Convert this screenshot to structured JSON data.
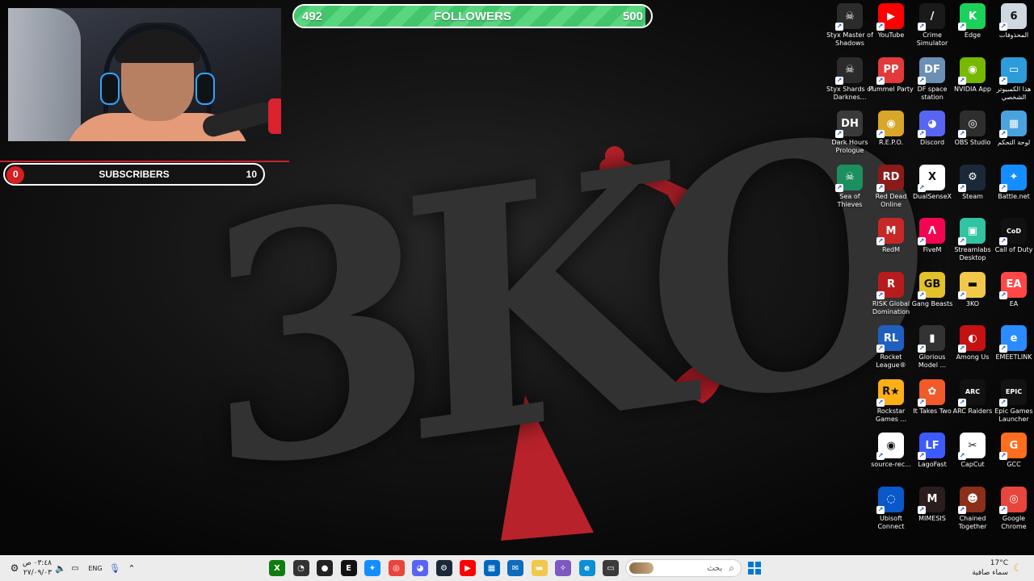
{
  "overlay": {
    "followers": {
      "current": "492",
      "title": "FOLLOWERS",
      "goal": "500",
      "progress": 0.984
    },
    "subscribers": {
      "current": "0",
      "title": "SUBSCRIBERS",
      "goal": "10",
      "progress": 0.0
    }
  },
  "wallpaper": {
    "logo_text": "3KO"
  },
  "desktop_icons": [
    {
      "label": "Styx Master of Shadows",
      "icon": "styx-icon",
      "color": "#2b2b2b",
      "glyph": "☠"
    },
    {
      "label": "YouTube",
      "icon": "youtube-icon",
      "color": "#ff0000",
      "glyph": "▶"
    },
    {
      "label": "Crime Simulator",
      "icon": "crime-simulator-icon",
      "color": "#1a1a1a",
      "glyph": "/"
    },
    {
      "label": "Edge",
      "icon": "edge-icon",
      "color": "#1bd15a",
      "glyph": "K"
    },
    {
      "label": "المحذوفات",
      "icon": "recycle-bin-icon",
      "color": "#cfd8e0",
      "glyph": "6"
    },
    {
      "label": "Styx Shards of Darknes...",
      "icon": "styx-shards-icon",
      "color": "#2b2b2b",
      "glyph": "☠"
    },
    {
      "label": "Pummel Party",
      "icon": "pummel-party-icon",
      "color": "#e23a3a",
      "glyph": "PP"
    },
    {
      "label": "DF space station",
      "icon": "df-space-station-icon",
      "color": "#6b8fb5",
      "glyph": "DF"
    },
    {
      "label": "NVIDIA App",
      "icon": "nvidia-icon",
      "color": "#76b900",
      "glyph": "◉"
    },
    {
      "label": "هذا الكمبيوتر الشخصي",
      "icon": "this-pc-icon",
      "color": "#2d9cdb",
      "glyph": "▭"
    },
    {
      "label": "Dark Hours Prologue",
      "icon": "dark-hours-icon",
      "color": "#3a3a3a",
      "glyph": "DH"
    },
    {
      "label": "R.E.P.O.",
      "icon": "repo-icon",
      "color": "#d8a628",
      "glyph": "◉"
    },
    {
      "label": "Discord",
      "icon": "discord-icon",
      "color": "#5865f2",
      "glyph": "◕"
    },
    {
      "label": "OBS Studio",
      "icon": "obs-icon",
      "color": "#2e2e2e",
      "glyph": "◎"
    },
    {
      "label": "لوحة التحكم",
      "icon": "control-panel-icon",
      "color": "#4aa3df",
      "glyph": "▦"
    },
    {
      "label": "Sea of Thieves",
      "icon": "sea-of-thieves-icon",
      "color": "#1c8f5e",
      "glyph": "☠"
    },
    {
      "label": "Red Dead Online",
      "icon": "red-dead-online-icon",
      "color": "#8b1a1a",
      "glyph": "RD"
    },
    {
      "label": "DualSenseX",
      "icon": "dualsensex-icon",
      "color": "#ffffff",
      "glyph": "X"
    },
    {
      "label": "Steam",
      "icon": "steam-icon",
      "color": "#1b2838",
      "glyph": "⚙"
    },
    {
      "label": "Battle.net",
      "icon": "battlenet-icon",
      "color": "#148eff",
      "glyph": "✦"
    },
    {
      "label": "RedM",
      "icon": "redm-icon",
      "color": "#c62828",
      "glyph": "M"
    },
    {
      "label": "FiveM",
      "icon": "fivem-icon",
      "color": "#f40552",
      "glyph": "Λ"
    },
    {
      "label": "Streamlabs Desktop",
      "icon": "streamlabs-icon",
      "color": "#31c3a2",
      "glyph": "▣"
    },
    {
      "label": "Call of Duty",
      "icon": "call-of-duty-icon",
      "color": "#111111",
      "glyph": "CoD"
    },
    {
      "label": "RISK Global Domination",
      "icon": "risk-icon",
      "color": "#b71c1c",
      "glyph": "R"
    },
    {
      "label": "Gang Beasts",
      "icon": "gang-beasts-icon",
      "color": "#e2c12a",
      "glyph": "GB"
    },
    {
      "label": "3KO",
      "icon": "folder-icon",
      "color": "#f2c84b",
      "glyph": "▬"
    },
    {
      "label": "EA",
      "icon": "ea-icon",
      "color": "#ff4747",
      "glyph": "EA"
    },
    {
      "label": "Rocket League®",
      "icon": "rocket-league-icon",
      "color": "#1f5fbf",
      "glyph": "RL"
    },
    {
      "label": "Glorious Model ...",
      "icon": "glorious-icon",
      "color": "#333333",
      "glyph": "▮"
    },
    {
      "label": "Among Us",
      "icon": "among-us-icon",
      "color": "#c51111",
      "glyph": "◐"
    },
    {
      "label": "EMEETLINK",
      "icon": "emeetlink-icon",
      "color": "#2b8cff",
      "glyph": "e"
    },
    {
      "label": "Rockstar Games ...",
      "icon": "rockstar-icon",
      "color": "#fcaf17",
      "glyph": "R★"
    },
    {
      "label": "It Takes Two",
      "icon": "it-takes-two-icon",
      "color": "#f25a29",
      "glyph": "✿"
    },
    {
      "label": "ARC Raiders",
      "icon": "arc-raiders-icon",
      "color": "#111111",
      "glyph": "ARC"
    },
    {
      "label": "Epic Games Launcher",
      "icon": "epic-games-icon",
      "color": "#121212",
      "glyph": "EPIC"
    },
    {
      "label": "source-rec...",
      "icon": "source-record-icon",
      "color": "#ffffff",
      "glyph": "◉"
    },
    {
      "label": "LagoFast",
      "icon": "lagofast-icon",
      "color": "#3d5afe",
      "glyph": "LF"
    },
    {
      "label": "CapCut",
      "icon": "capcut-icon",
      "color": "#ffffff",
      "glyph": "✂"
    },
    {
      "label": "GCC",
      "icon": "gcc-icon",
      "color": "#ff6d1f",
      "glyph": "G"
    },
    {
      "label": "Ubisoft Connect",
      "icon": "ubisoft-icon",
      "color": "#0a58ca",
      "glyph": "◌"
    },
    {
      "label": "MIMESIS",
      "icon": "mimesis-icon",
      "color": "#2b1d1d",
      "glyph": "M"
    },
    {
      "label": "Chained Together",
      "icon": "chained-together-icon",
      "color": "#8b2f1a",
      "glyph": "☻"
    },
    {
      "label": "Google Chrome",
      "icon": "chrome-icon",
      "color": "#e8453c",
      "glyph": "◎"
    }
  ],
  "taskbar": {
    "clock_time": "٠٣:٤٨ ص",
    "clock_date": "٢٧/٠٩/٠٣",
    "lang": "ENG",
    "search_placeholder": "بحث",
    "weather_temp": "17°C",
    "weather_desc": "سماء صافية",
    "apps": [
      {
        "name": "xbox-icon",
        "color": "#107c10",
        "glyph": "X"
      },
      {
        "name": "speed-icon",
        "color": "#333333",
        "glyph": "◔"
      },
      {
        "name": "record-icon",
        "color": "#222222",
        "glyph": "●"
      },
      {
        "name": "epic-icon",
        "color": "#121212",
        "glyph": "E"
      },
      {
        "name": "battlenet-icon",
        "color": "#148eff",
        "glyph": "✦"
      },
      {
        "name": "chrome-icon",
        "color": "#e8453c",
        "glyph": "◎"
      },
      {
        "name": "discord-icon",
        "color": "#5865f2",
        "glyph": "◕"
      },
      {
        "name": "steam-icon",
        "color": "#1b2838",
        "glyph": "⚙"
      },
      {
        "name": "youtube-icon",
        "color": "#ff0000",
        "glyph": "▶"
      },
      {
        "name": "store-icon",
        "color": "#0067c0",
        "glyph": "▦"
      },
      {
        "name": "outlook-icon",
        "color": "#0f6cbd",
        "glyph": "✉"
      },
      {
        "name": "file-explorer-icon",
        "color": "#f2c84b",
        "glyph": "▬"
      },
      {
        "name": "copilot-icon",
        "color": "#7e57c2",
        "glyph": "✧"
      },
      {
        "name": "edge-icon",
        "color": "#0c8fd6",
        "glyph": "e"
      },
      {
        "name": "task-view-icon",
        "color": "#3a3a3a",
        "glyph": "▭"
      }
    ]
  }
}
